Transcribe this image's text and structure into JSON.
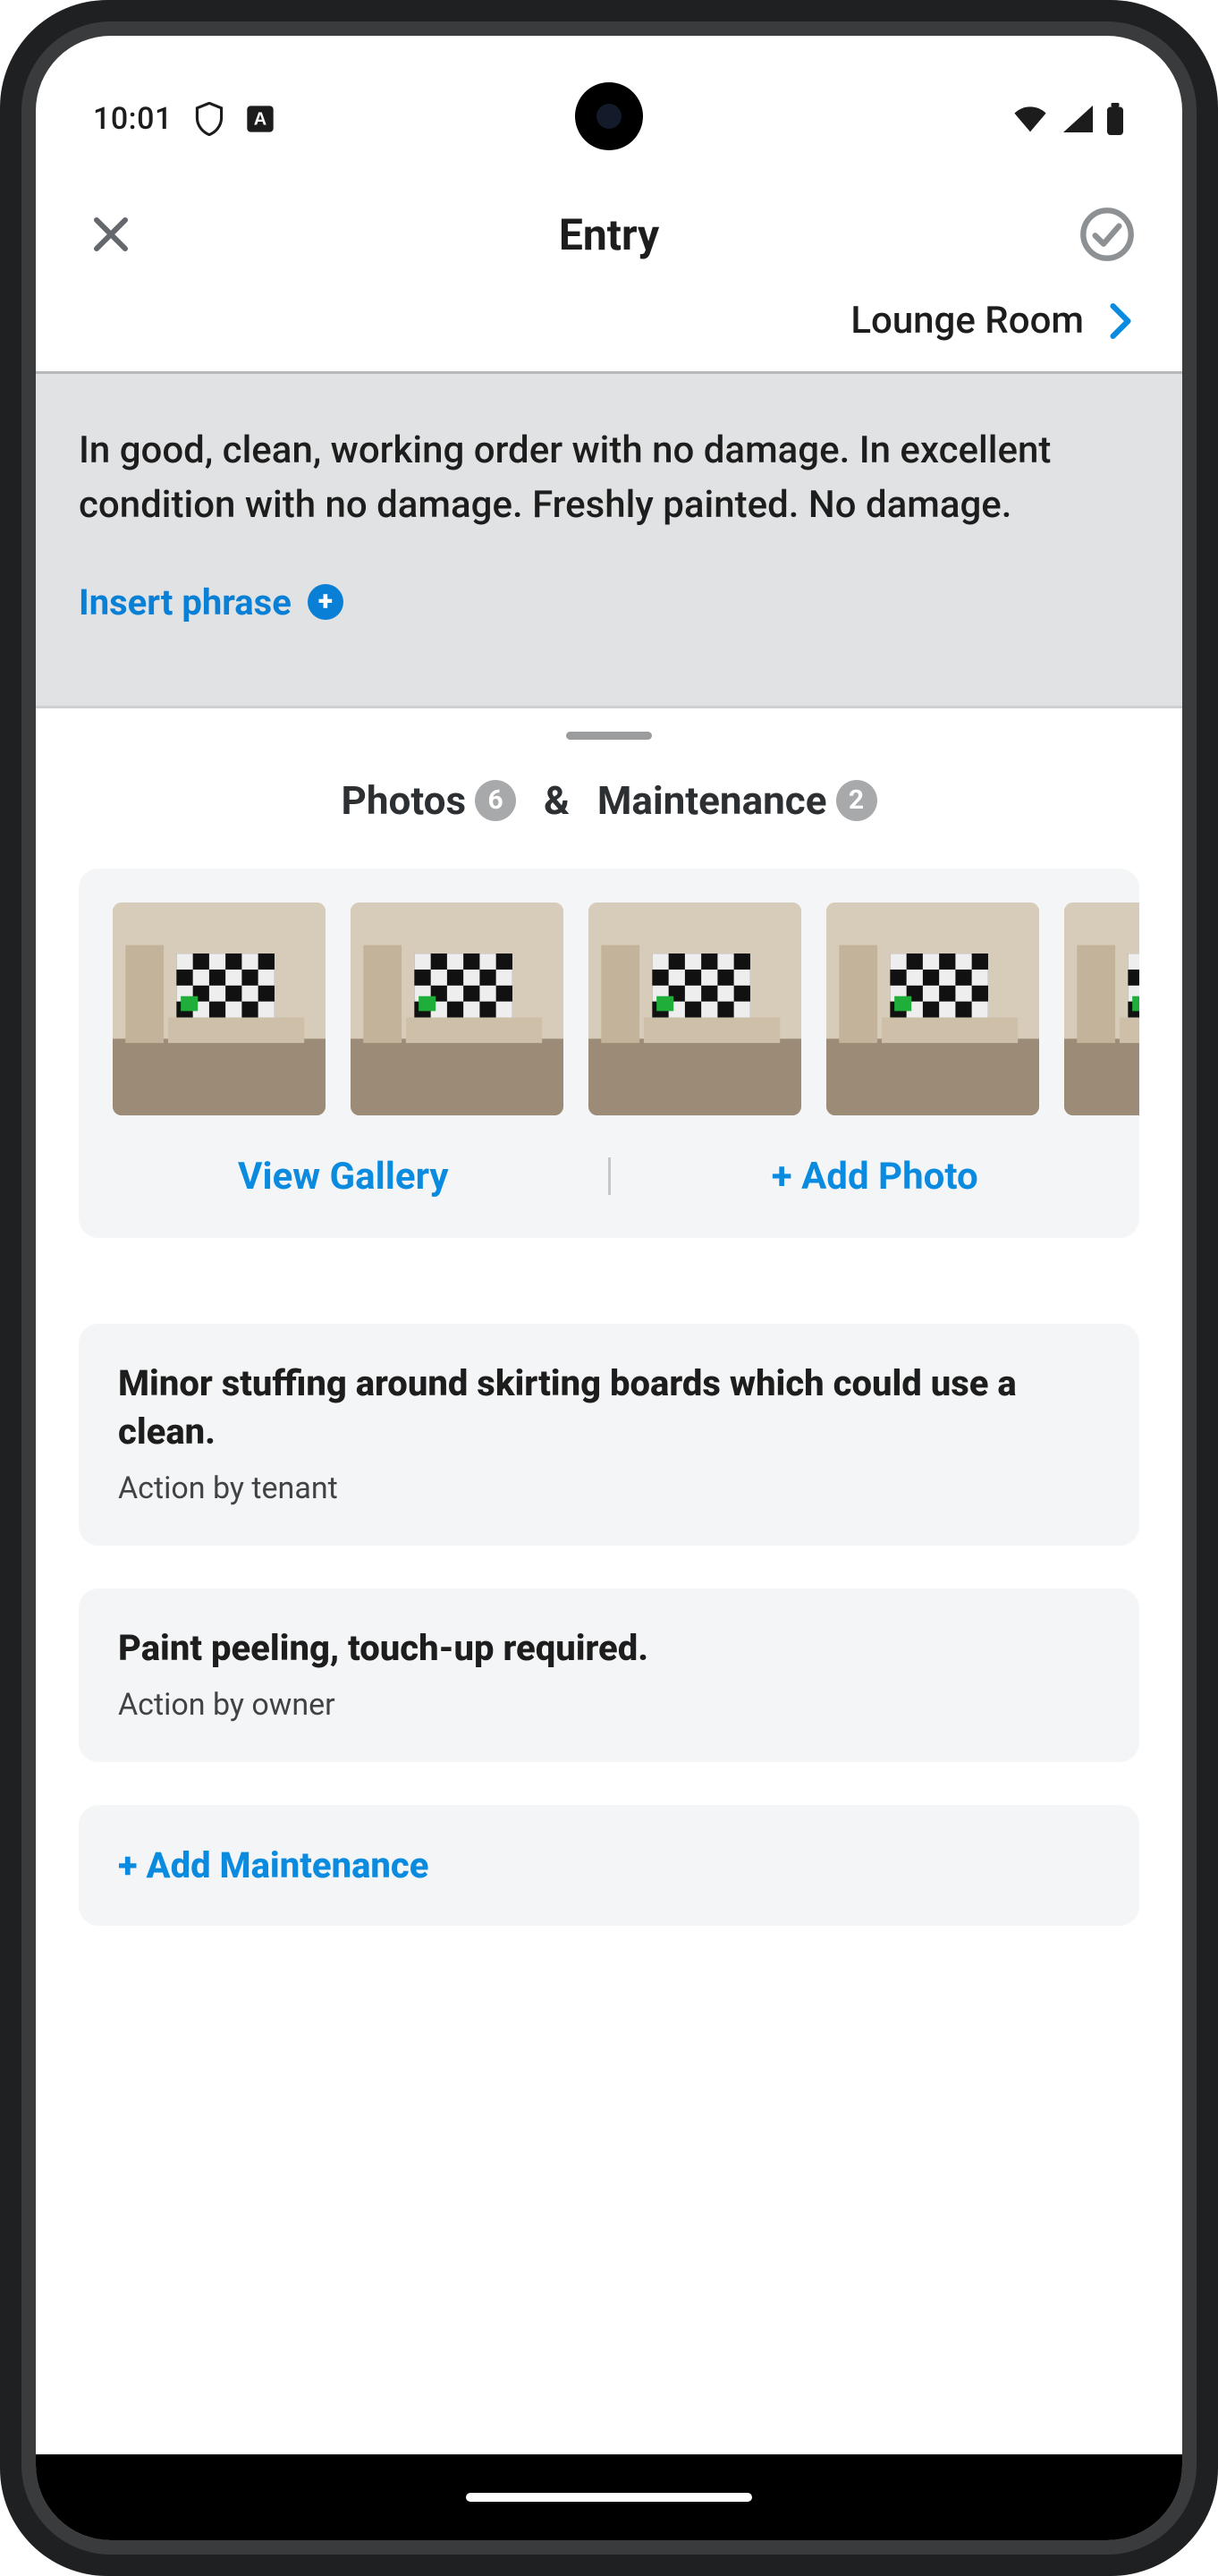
{
  "status": {
    "time": "10:01"
  },
  "header": {
    "title": "Entry"
  },
  "breadcrumb": {
    "label": "Lounge Room"
  },
  "note": {
    "text": "In good, clean, working order with no damage. In excellent condition with no damage. Freshly painted. No damage.",
    "insert_label": "Insert phrase"
  },
  "section": {
    "photos_label": "Photos",
    "photos_count": "6",
    "join": "&",
    "maintenance_label": "Maintenance",
    "maintenance_count": "2"
  },
  "gallery": {
    "view_label": "View Gallery",
    "add_label": "+ Add Photo"
  },
  "maintenance": {
    "items": [
      {
        "title": "Minor stuffing around skirting boards which could use a clean.",
        "action": "Action by tenant"
      },
      {
        "title": "Paint peeling, touch-up required.",
        "action": "Action by owner"
      }
    ],
    "add_label": "+ Add Maintenance"
  }
}
